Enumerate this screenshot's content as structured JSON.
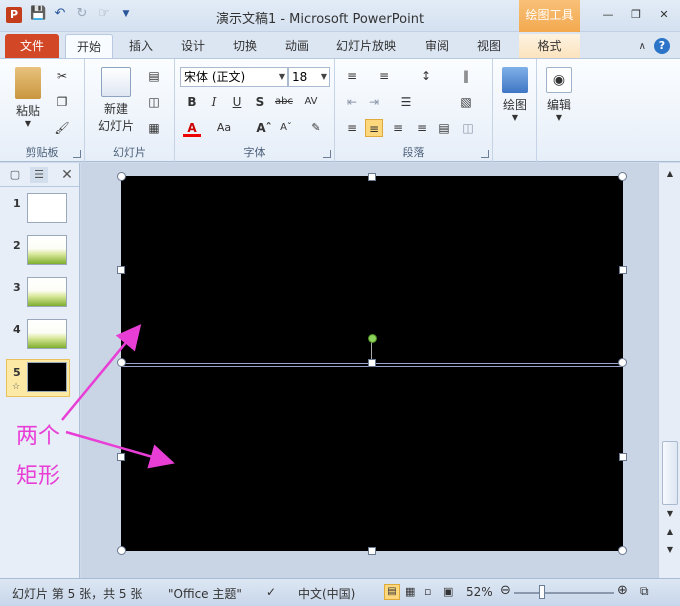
{
  "window": {
    "title": "演示文稿1 - Microsoft PowerPoint",
    "app_icon_letter": "P",
    "tool_context": "绘图工具"
  },
  "tabs": {
    "file": "文件",
    "home": "开始",
    "insert": "插入",
    "design": "设计",
    "transitions": "切换",
    "animations": "动画",
    "slideshow": "幻灯片放映",
    "review": "审阅",
    "view": "视图",
    "format": "格式"
  },
  "ribbon": {
    "clipboard": {
      "label": "剪贴板",
      "paste": "粘贴"
    },
    "slides": {
      "label": "幻灯片",
      "new_slide_line1": "新建",
      "new_slide_line2": "幻灯片"
    },
    "font": {
      "label": "字体",
      "font_name": "宋体 (正文)",
      "font_size": "18"
    },
    "paragraph": {
      "label": "段落"
    },
    "drawing": {
      "label": "绘图"
    },
    "editing": {
      "label": "编辑"
    }
  },
  "slides_pane": {
    "slides": [
      {
        "num": "1",
        "style": "blank"
      },
      {
        "num": "2",
        "style": "landscape"
      },
      {
        "num": "3",
        "style": "landscape"
      },
      {
        "num": "4",
        "style": "landscape"
      },
      {
        "num": "5",
        "style": "black",
        "selected": true
      }
    ]
  },
  "annotation": {
    "line1": "两个",
    "line2": "矩形",
    "color": "#e83ed6"
  },
  "statusbar": {
    "slide_info": "幻灯片 第 5 张，共 5 张",
    "theme": "\"Office 主题\"",
    "language": "中文(中国)",
    "zoom": "52%"
  },
  "colors": {
    "file_tab": "#d24726",
    "tool_context": "#f3a94e",
    "rotate_handle": "#8bd35a"
  }
}
